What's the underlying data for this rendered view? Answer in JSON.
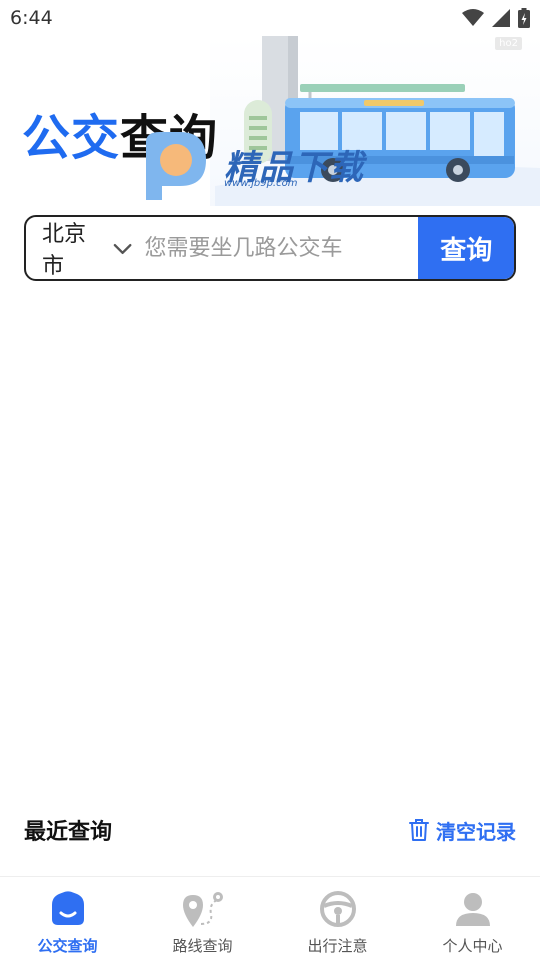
{
  "status_bar": {
    "time": "6:44",
    "badge": "ho2"
  },
  "hero": {
    "title_blue": "公交",
    "title_black": "查询",
    "watermark_text": "精品下载",
    "watermark_url": "www.jb9p.com"
  },
  "search": {
    "city": "北京市",
    "placeholder": "您需要坐几路公交车",
    "button_label": "查询"
  },
  "recent": {
    "title": "最近查询",
    "clear_label": "清空记录"
  },
  "nav": {
    "items": [
      {
        "label": "公交查询",
        "icon": "bus-home-icon"
      },
      {
        "label": "路线查询",
        "icon": "route-pin-icon"
      },
      {
        "label": "出行注意",
        "icon": "steering-wheel-icon"
      },
      {
        "label": "个人中心",
        "icon": "user-icon"
      }
    ]
  },
  "colors": {
    "accent": "#2f6ff2",
    "nav_inactive": "#bdbdbd"
  }
}
